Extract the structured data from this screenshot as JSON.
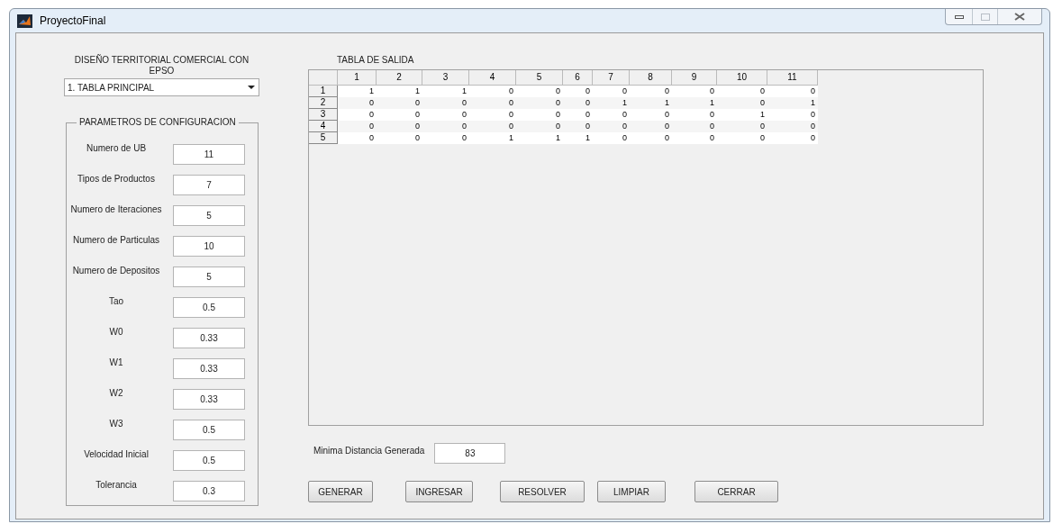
{
  "window": {
    "title": "ProyectoFinal",
    "restore_disabled": true
  },
  "header": {
    "title": "DISEÑO TERRITORIAL COMERCIAL CON EPSO"
  },
  "dropdown": {
    "value": "1. TABLA PRINCIPAL"
  },
  "parameters": {
    "title": "PARAMETROS DE CONFIGURACION",
    "fields": [
      {
        "label": "Numero de UB",
        "value": "11"
      },
      {
        "label": "Tipos de Productos",
        "value": "7"
      },
      {
        "label": "Numero de Iteraciones",
        "value": "5"
      },
      {
        "label": "Numero de Particulas",
        "value": "10"
      },
      {
        "label": "Numero de Depositos",
        "value": "5"
      },
      {
        "label": "Tao",
        "value": "0.5"
      },
      {
        "label": "W0",
        "value": "0.33"
      },
      {
        "label": "W1",
        "value": "0.33"
      },
      {
        "label": "W2",
        "value": "0.33"
      },
      {
        "label": "W3",
        "value": "0.5"
      },
      {
        "label": "Velocidad Inicial",
        "value": "0.5"
      },
      {
        "label": "Tolerancia",
        "value": "0.3"
      }
    ]
  },
  "table": {
    "title": "TABLA DE SALIDA",
    "columns": [
      "1",
      "2",
      "3",
      "4",
      "5",
      "6",
      "7",
      "8",
      "9",
      "10",
      "11"
    ],
    "rows": [
      {
        "header": "1",
        "cells": [
          "1",
          "1",
          "1",
          "0",
          "0",
          "0",
          "0",
          "0",
          "0",
          "0",
          "0"
        ]
      },
      {
        "header": "2",
        "cells": [
          "0",
          "0",
          "0",
          "0",
          "0",
          "0",
          "1",
          "1",
          "1",
          "0",
          "1"
        ]
      },
      {
        "header": "3",
        "cells": [
          "0",
          "0",
          "0",
          "0",
          "0",
          "0",
          "0",
          "0",
          "0",
          "1",
          "0"
        ]
      },
      {
        "header": "4",
        "cells": [
          "0",
          "0",
          "0",
          "0",
          "0",
          "0",
          "0",
          "0",
          "0",
          "0",
          "0"
        ]
      },
      {
        "header": "5",
        "cells": [
          "0",
          "0",
          "0",
          "1",
          "1",
          "1",
          "0",
          "0",
          "0",
          "0",
          "0"
        ]
      }
    ]
  },
  "result": {
    "label": "Minima Distancia Generada",
    "value": "83"
  },
  "buttons": [
    "GENERAR",
    "INGRESAR",
    "RESOLVER",
    "LIMPIAR",
    "CERRAR"
  ]
}
